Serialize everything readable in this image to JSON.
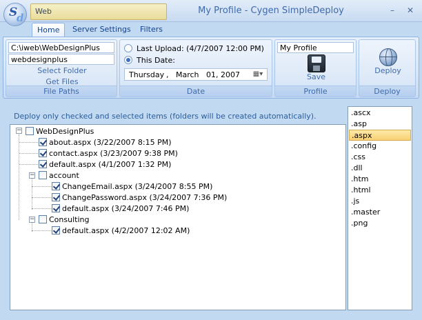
{
  "titlebar": {
    "logo_letters": [
      "S",
      "d"
    ],
    "quick_access_text": "Web",
    "title": "My Profile - Cygen SimpleDeploy",
    "minimize": "–",
    "close": "✕"
  },
  "tabs": [
    {
      "label": "Home",
      "active": true
    },
    {
      "label": "Server Settings",
      "active": false
    },
    {
      "label": "Filters",
      "active": false
    }
  ],
  "file_paths": {
    "path_value": "C:\\iweb\\WebDesignPlus",
    "name_value": "webdesignplus",
    "select_folder": "Select Folder",
    "get_files": "Get Files",
    "label": "File Paths"
  },
  "date": {
    "last_upload": "Last Upload: (4/7/2007 12:00 PM)",
    "this_date": "This Date:",
    "selected": "this_date",
    "weekday": "Thursday",
    "sep": ",",
    "month": "March",
    "day_year": "01, 2007",
    "label": "Date"
  },
  "profile": {
    "name": "My Profile",
    "save": "Save",
    "label": "Profile"
  },
  "deploy": {
    "button": "Deploy",
    "label": "Deploy"
  },
  "main": {
    "instructions": "Deploy only checked and selected items (folders will be created automatically).",
    "tree": [
      {
        "label": "WebDesignPlus",
        "checked": false,
        "level": 0,
        "expander": "−"
      },
      {
        "label": "about.aspx (3/22/2007 8:15 PM)",
        "checked": true,
        "level": 1
      },
      {
        "label": "contact.aspx (3/23/2007 9:38 PM)",
        "checked": true,
        "level": 1
      },
      {
        "label": "default.aspx (4/1/2007 1:32 PM)",
        "checked": true,
        "level": 1
      },
      {
        "label": "account",
        "checked": false,
        "level": 1,
        "expander": "−"
      },
      {
        "label": "ChangeEmail.aspx (3/24/2007 8:55 PM)",
        "checked": true,
        "level": 2
      },
      {
        "label": "ChangePassword.aspx (3/24/2007 7:36 PM)",
        "checked": true,
        "level": 2
      },
      {
        "label": "default.aspx (3/24/2007 7:46 PM)",
        "checked": true,
        "level": 2
      },
      {
        "label": "Consulting",
        "checked": false,
        "level": 1,
        "expander": "−"
      },
      {
        "label": "default.aspx (4/2/2007 12:02 AM)",
        "checked": true,
        "level": 2
      }
    ],
    "extensions": [
      ".ascx",
      ".asp",
      ".aspx",
      ".config",
      ".css",
      ".dll",
      ".htm",
      ".html",
      ".js",
      ".master",
      ".png"
    ],
    "selected_extension": ".aspx"
  }
}
